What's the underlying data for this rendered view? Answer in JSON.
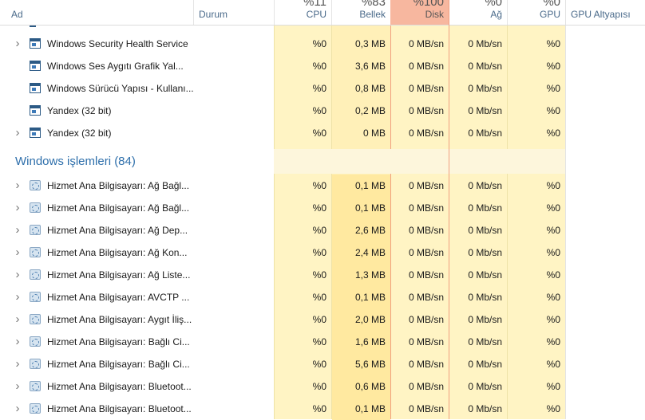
{
  "header": {
    "columns": [
      {
        "key": "name",
        "label": "Ad",
        "pct": ""
      },
      {
        "key": "status",
        "label": "Durum",
        "pct": ""
      },
      {
        "key": "cpu",
        "label": "CPU",
        "pct": "%11"
      },
      {
        "key": "mem",
        "label": "Bellek",
        "pct": "%83"
      },
      {
        "key": "disk",
        "label": "Disk",
        "pct": "%100"
      },
      {
        "key": "net",
        "label": "Ağ",
        "pct": "%0"
      },
      {
        "key": "gpu",
        "label": "GPU",
        "pct": "%0"
      },
      {
        "key": "gpu_engine",
        "label": "GPU Altyapısı",
        "pct": ""
      }
    ]
  },
  "apps_rows": [
    {
      "expand": true,
      "icon": "window-icon",
      "name": "Windows Security Health Service",
      "cpu": "%0",
      "mem": "0,3 MB",
      "disk": "0 MB/sn",
      "net": "0 Mb/sn",
      "gpu": "%0"
    },
    {
      "expand": false,
      "icon": "window-icon",
      "name": "Windows Ses Aygıtı Grafik Yal...",
      "cpu": "%0",
      "mem": "3,6 MB",
      "disk": "0 MB/sn",
      "net": "0 Mb/sn",
      "gpu": "%0"
    },
    {
      "expand": false,
      "icon": "window-icon",
      "name": "Windows Sürücü Yapısı - Kullanı...",
      "cpu": "%0",
      "mem": "0,8 MB",
      "disk": "0 MB/sn",
      "net": "0 Mb/sn",
      "gpu": "%0"
    },
    {
      "expand": false,
      "icon": "window-icon",
      "name": "Yandex (32 bit)",
      "cpu": "%0",
      "mem": "0,2 MB",
      "disk": "0 MB/sn",
      "net": "0 Mb/sn",
      "gpu": "%0"
    },
    {
      "expand": true,
      "icon": "window-icon",
      "name": "Yandex (32 bit)",
      "cpu": "%0",
      "mem": "0 MB",
      "disk": "0 MB/sn",
      "net": "0 Mb/sn",
      "gpu": "%0"
    }
  ],
  "windows_section": {
    "title": "Windows işlemleri (84)"
  },
  "win_rows": [
    {
      "expand": true,
      "icon": "gear-icon",
      "name": "Hizmet Ana Bilgisayarı: Ağ Bağl...",
      "cpu": "%0",
      "mem": "0,1 MB",
      "disk": "0 MB/sn",
      "net": "0 Mb/sn",
      "gpu": "%0"
    },
    {
      "expand": true,
      "icon": "gear-icon",
      "name": "Hizmet Ana Bilgisayarı: Ağ Bağl...",
      "cpu": "%0",
      "mem": "0,1 MB",
      "disk": "0 MB/sn",
      "net": "0 Mb/sn",
      "gpu": "%0"
    },
    {
      "expand": true,
      "icon": "gear-icon",
      "name": "Hizmet Ana Bilgisayarı: Ağ Dep...",
      "cpu": "%0",
      "mem": "2,6 MB",
      "disk": "0 MB/sn",
      "net": "0 Mb/sn",
      "gpu": "%0"
    },
    {
      "expand": true,
      "icon": "gear-icon",
      "name": "Hizmet Ana Bilgisayarı: Ağ Kon...",
      "cpu": "%0",
      "mem": "2,4 MB",
      "disk": "0 MB/sn",
      "net": "0 Mb/sn",
      "gpu": "%0"
    },
    {
      "expand": true,
      "icon": "gear-icon",
      "name": "Hizmet Ana Bilgisayarı: Ağ Liste...",
      "cpu": "%0",
      "mem": "1,3 MB",
      "disk": "0 MB/sn",
      "net": "0 Mb/sn",
      "gpu": "%0"
    },
    {
      "expand": true,
      "icon": "gear-icon",
      "name": "Hizmet Ana Bilgisayarı: AVCTP ...",
      "cpu": "%0",
      "mem": "0,1 MB",
      "disk": "0 MB/sn",
      "net": "0 Mb/sn",
      "gpu": "%0"
    },
    {
      "expand": true,
      "icon": "gear-icon",
      "name": "Hizmet Ana Bilgisayarı: Aygıt İliş...",
      "cpu": "%0",
      "mem": "2,0 MB",
      "disk": "0 MB/sn",
      "net": "0 Mb/sn",
      "gpu": "%0"
    },
    {
      "expand": true,
      "icon": "gear-icon",
      "name": "Hizmet Ana Bilgisayarı: Bağlı Ci...",
      "cpu": "%0",
      "mem": "1,6 MB",
      "disk": "0 MB/sn",
      "net": "0 Mb/sn",
      "gpu": "%0"
    },
    {
      "expand": true,
      "icon": "gear-icon",
      "name": "Hizmet Ana Bilgisayarı: Bağlı Ci...",
      "cpu": "%0",
      "mem": "5,6 MB",
      "disk": "0 MB/sn",
      "net": "0 Mb/sn",
      "gpu": "%0"
    },
    {
      "expand": true,
      "icon": "gear-icon",
      "name": "Hizmet Ana Bilgisayarı: Bluetoot...",
      "cpu": "%0",
      "mem": "0,6 MB",
      "disk": "0 MB/sn",
      "net": "0 Mb/sn",
      "gpu": "%0"
    },
    {
      "expand": true,
      "icon": "gear-icon",
      "name": "Hizmet Ana Bilgisayarı: Bluetoot...",
      "cpu": "%0",
      "mem": "0,1 MB",
      "disk": "0 MB/sn",
      "net": "0 Mb/sn",
      "gpu": "%0"
    }
  ],
  "colors": {
    "disk_header": "#f7b79f",
    "cell_bg": "#fff4c4",
    "section_title": "#2e6fab"
  }
}
